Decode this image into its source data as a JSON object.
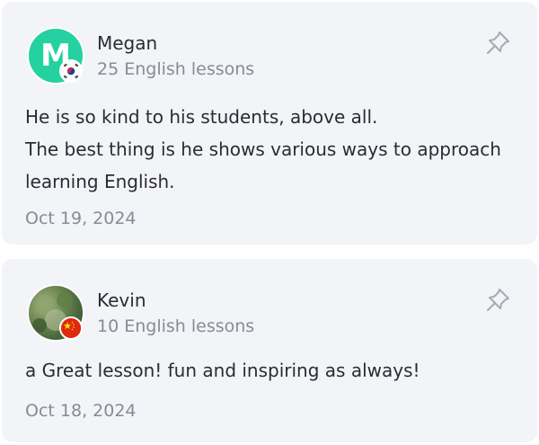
{
  "reviews": [
    {
      "avatar_letter": "M",
      "avatar_color": "#25d1a0",
      "flag": "south-korea",
      "name": "Megan",
      "lessons": "25 English lessons",
      "text_lines": [
        "He is so kind to his students,  above all.",
        "The best thing is he shows various ways to approach learning English."
      ],
      "date": "Oct 19, 2024",
      "pin_icon": "pin-icon"
    },
    {
      "avatar_type": "photo",
      "flag": "china",
      "name": "Kevin",
      "lessons": "10 English lessons",
      "text_lines": [
        "a Great lesson! fun and inspiring as always!"
      ],
      "date": "Oct 18, 2024",
      "pin_icon": "pin-icon"
    }
  ]
}
